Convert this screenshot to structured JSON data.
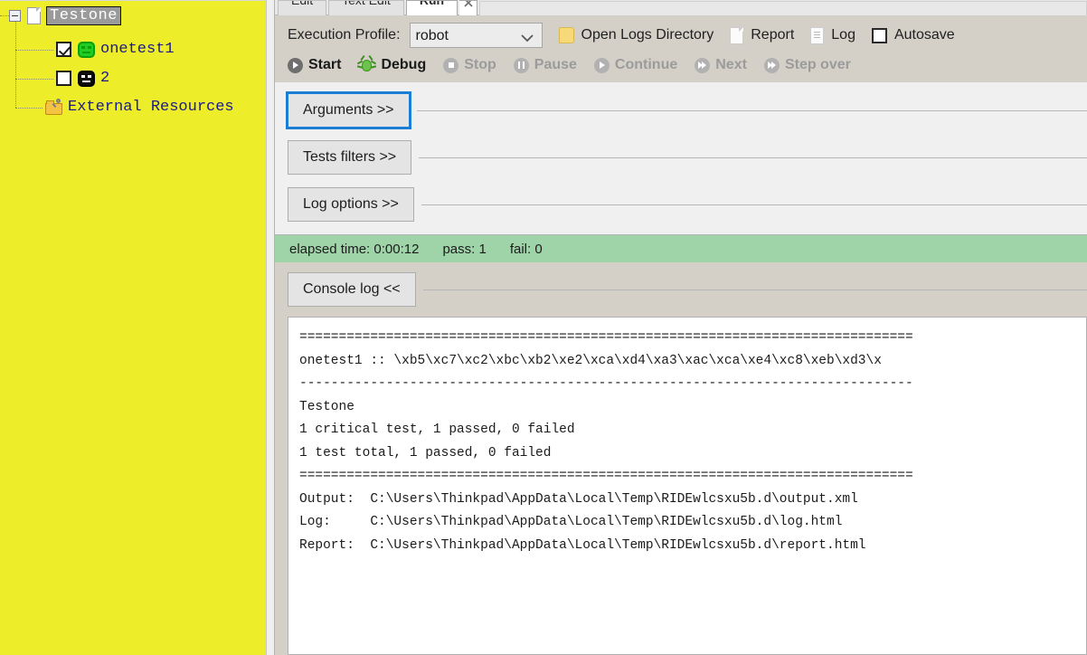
{
  "tree": {
    "root": {
      "label": "Testone",
      "icon": "file-icon",
      "selected": true
    },
    "children": [
      {
        "label": "onetest1",
        "checked": true,
        "icon": "robot-green-icon"
      },
      {
        "label": "2",
        "checked": false,
        "icon": "robot-black-icon"
      }
    ],
    "external_resources": {
      "label": "External Resources",
      "icon": "folder-key-icon"
    }
  },
  "tabs": [
    {
      "label": "Edit",
      "active": false
    },
    {
      "label": "Text Edit",
      "active": false
    },
    {
      "label": "Run",
      "active": true
    }
  ],
  "toolbar": {
    "profile_label": "Execution Profile:",
    "profile_value": "robot",
    "profile_options": [
      "robot"
    ],
    "open_logs_directory": "Open Logs Directory",
    "report": "Report",
    "log": "Log",
    "autosave": "Autosave",
    "autosave_checked": false
  },
  "run_controls": [
    {
      "label": "Start",
      "enabled": true,
      "icon": "play-circle-icon"
    },
    {
      "label": "Debug",
      "enabled": true,
      "icon": "bug-icon"
    },
    {
      "label": "Stop",
      "enabled": false,
      "icon": "stop-circle-icon"
    },
    {
      "label": "Pause",
      "enabled": false,
      "icon": "pause-circle-icon"
    },
    {
      "label": "Continue",
      "enabled": false,
      "icon": "play-circle-icon"
    },
    {
      "label": "Next",
      "enabled": false,
      "icon": "next-circle-icon"
    },
    {
      "label": "Step over",
      "enabled": false,
      "icon": "step-over-circle-icon"
    }
  ],
  "sections": [
    {
      "label": "Arguments >>",
      "focused": true
    },
    {
      "label": "Tests filters >>",
      "focused": false
    },
    {
      "label": "Log options >>",
      "focused": false
    }
  ],
  "status": {
    "elapsed": "elapsed time: 0:00:12",
    "pass": "pass: 1",
    "fail": "fail: 0",
    "color": "#9fd3a8"
  },
  "console_toggle": {
    "label": "Console log <<"
  },
  "console_output": [
    "==============================================================================",
    "onetest1 :: \\xb5\\xc7\\xc2\\xbc\\xb2\\xe2\\xca\\xd4\\xa3\\xac\\xca\\xe4\\xc8\\xeb\\xd3\\x",
    "------------------------------------------------------------------------------",
    "Testone",
    "1 critical test, 1 passed, 0 failed",
    "1 test total, 1 passed, 0 failed",
    "==============================================================================",
    "Output:  C:\\Users\\Thinkpad\\AppData\\Local\\Temp\\RIDEwlcsxu5b.d\\output.xml",
    "Log:     C:\\Users\\Thinkpad\\AppData\\Local\\Temp\\RIDEwlcsxu5b.d\\log.html",
    "Report:  C:\\Users\\Thinkpad\\AppData\\Local\\Temp\\RIDEwlcsxu5b.d\\report.html"
  ]
}
